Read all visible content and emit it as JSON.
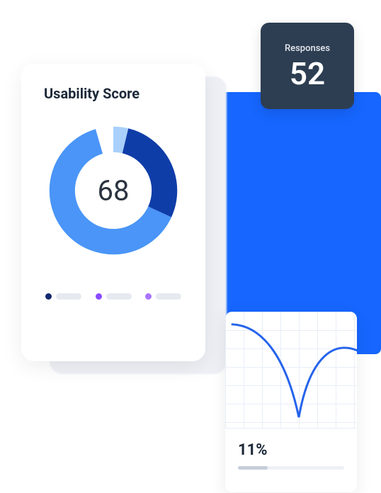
{
  "usability": {
    "title": "Usability Score",
    "score": 68,
    "legend_colors": [
      "#14286e",
      "#8a4bff",
      "#a974ff"
    ]
  },
  "responses": {
    "label": "Responses",
    "value": 52
  },
  "trend": {
    "value_display": "11%",
    "progress_pct": 28
  },
  "chart_data": [
    {
      "type": "pie",
      "title": "Usability Score",
      "center_value": 68,
      "segments": [
        {
          "name": "dark-blue",
          "color": "#0f3da8",
          "percent": 28
        },
        {
          "name": "mid-blue",
          "color": "#4a95f7",
          "percent": 64
        },
        {
          "name": "light-blue",
          "color": "#a9d0fb",
          "percent": 4
        },
        {
          "name": "empty",
          "color": "transparent",
          "percent": 4
        }
      ],
      "legend_colors": [
        "#14286e",
        "#8a4bff",
        "#a974ff"
      ]
    },
    {
      "type": "line",
      "title": "",
      "value_label": "11%",
      "x": [
        0,
        0.5,
        1
      ],
      "y": [
        1,
        0,
        0.7
      ],
      "ylim": [
        0,
        1
      ]
    }
  ]
}
